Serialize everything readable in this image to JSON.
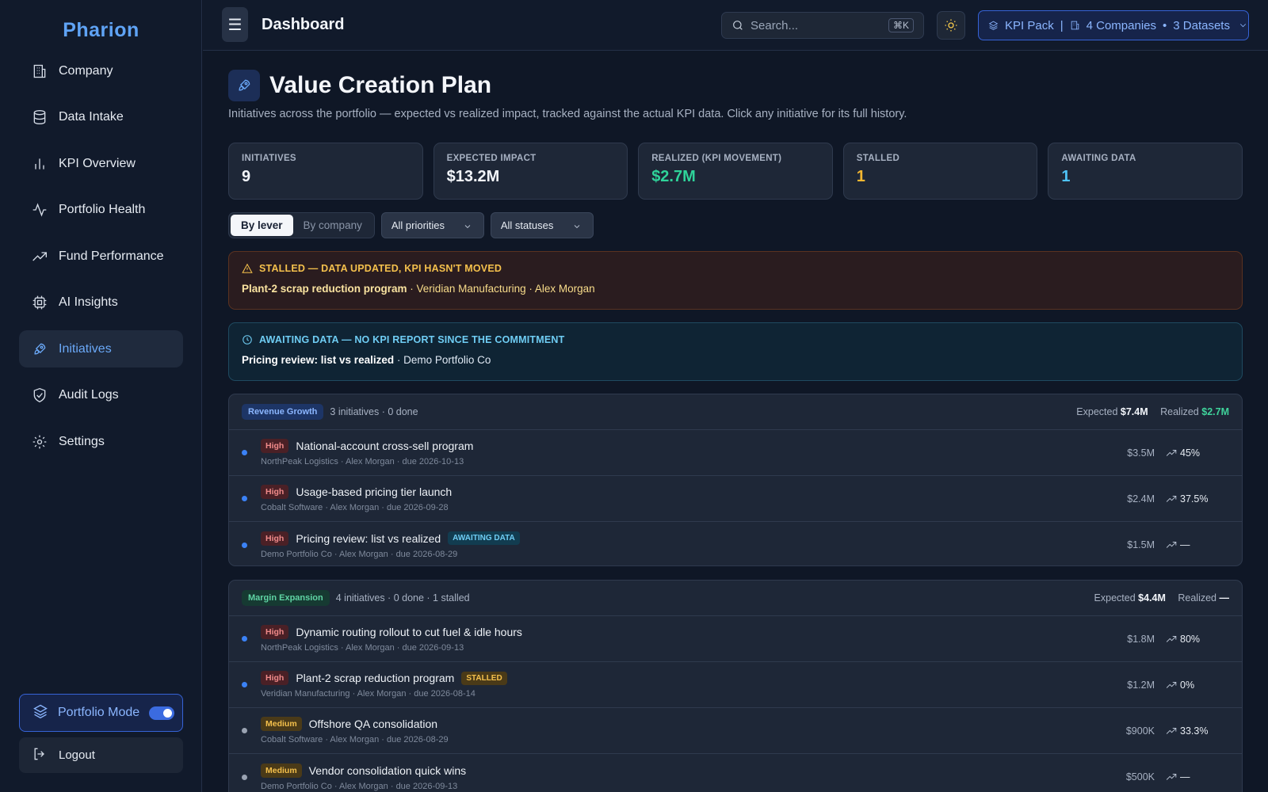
{
  "brand": "Pharion",
  "sidebar": {
    "items": [
      {
        "label": "Company"
      },
      {
        "label": "Data Intake"
      },
      {
        "label": "KPI Overview"
      },
      {
        "label": "Portfolio Health"
      },
      {
        "label": "Fund Performance"
      },
      {
        "label": "AI Insights"
      },
      {
        "label": "Initiatives"
      },
      {
        "label": "Audit Logs"
      },
      {
        "label": "Settings"
      }
    ],
    "portfolio_mode_label": "Portfolio Mode",
    "logout_label": "Logout"
  },
  "topbar": {
    "menu_icon": "☰",
    "title": "Dashboard",
    "search_placeholder": "Search...",
    "search_shortcut": "⌘K",
    "kpi_pack": "KPI Pack",
    "separator": "|",
    "companies": "4 Companies",
    "dot": "•",
    "datasets": "3 Datasets"
  },
  "page": {
    "title": "Value Creation Plan",
    "subtitle": "Initiatives across the portfolio — expected vs realized impact, tracked against the actual KPI data. Click any initiative for its full history."
  },
  "stats": [
    {
      "label": "INITIATIVES",
      "value": "9",
      "color": "#f2f5fa"
    },
    {
      "label": "EXPECTED IMPACT",
      "value": "$13.2M",
      "color": "#f2f5fa"
    },
    {
      "label": "REALIZED (KPI MOVEMENT)",
      "value": "$2.7M",
      "color": "#2fd39a"
    },
    {
      "label": "STALLED",
      "value": "1",
      "color": "#f4b731"
    },
    {
      "label": "AWAITING DATA",
      "value": "1",
      "color": "#4fc3f7"
    }
  ],
  "controls": {
    "by_lever": "By lever",
    "by_company": "By company",
    "priority_select": "All priorities",
    "status_select": "All statuses"
  },
  "alerts": {
    "stalled": {
      "header": "STALLED — DATA UPDATED, KPI HASN'T MOVED",
      "name": "Plant-2 scrap reduction program",
      "meta": " · Veridian Manufacturing · Alex Morgan"
    },
    "awaiting": {
      "header": "AWAITING DATA — NO KPI REPORT SINCE THE COMMITMENT",
      "name": "Pricing review: list vs realized",
      "meta": " · Demo Portfolio Co"
    }
  },
  "groups": [
    {
      "lever": "Revenue Growth",
      "meta": "3 initiatives · 0 done",
      "expected_label": "Expected",
      "expected": "$7.4M",
      "realized_label": "Realized",
      "realized": "$2.7M",
      "rows": [
        {
          "priority": "High",
          "name": "National-account cross-sell program",
          "tag": "",
          "sub": "NorthPeak Logistics · Alex Morgan · due 2026-10-13",
          "amount": "$3.5M",
          "progress": "45%"
        },
        {
          "priority": "High",
          "name": "Usage-based pricing tier launch",
          "tag": "",
          "sub": "Cobalt Software · Alex Morgan · due 2026-09-28",
          "amount": "$2.4M",
          "progress": "37.5%"
        },
        {
          "priority": "High",
          "name": "Pricing review: list vs realized",
          "tag": "AWAITING DATA",
          "sub": "Demo Portfolio Co · Alex Morgan · due 2026-08-29",
          "amount": "$1.5M",
          "progress": "—"
        }
      ]
    },
    {
      "lever": "Margin Expansion",
      "meta": "4 initiatives · 0 done · 1 stalled",
      "expected_label": "Expected",
      "expected": "$4.4M",
      "realized_label": "Realized",
      "realized": "—",
      "rows": [
        {
          "priority": "High",
          "name": "Dynamic routing rollout to cut fuel & idle hours",
          "tag": "",
          "sub": "NorthPeak Logistics · Alex Morgan · due 2026-09-13",
          "amount": "$1.8M",
          "progress": "80%"
        },
        {
          "priority": "High",
          "name": "Plant-2 scrap reduction program",
          "tag": "STALLED",
          "sub": "Veridian Manufacturing · Alex Morgan · due 2026-08-14",
          "amount": "$1.2M",
          "progress": "0%"
        },
        {
          "priority": "Medium",
          "name": "Offshore QA consolidation",
          "tag": "",
          "sub": "Cobalt Software · Alex Morgan · due 2026-08-29",
          "amount": "$900K",
          "progress": "33.3%"
        },
        {
          "priority": "Medium",
          "name": "Vendor consolidation quick wins",
          "tag": "",
          "sub": "Demo Portfolio Co · Alex Morgan · due 2026-09-13",
          "amount": "$500K",
          "progress": "—"
        }
      ]
    }
  ]
}
